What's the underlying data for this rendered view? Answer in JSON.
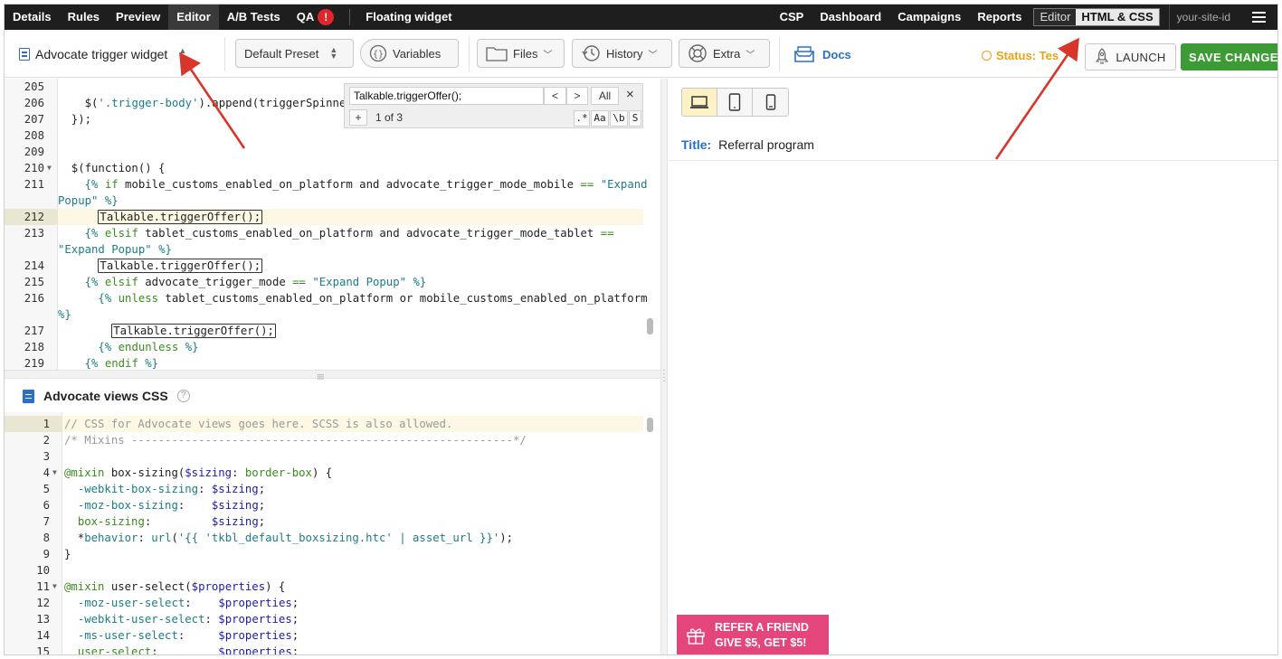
{
  "topnav": {
    "items": [
      {
        "label": "Details"
      },
      {
        "label": "Rules"
      },
      {
        "label": "Preview"
      },
      {
        "label": "Editor",
        "active": true
      },
      {
        "label": "A/B Tests"
      },
      {
        "label": "QA",
        "badge": "!"
      }
    ],
    "page_title": "Floating widget",
    "right_items": [
      {
        "label": "CSP"
      },
      {
        "label": "Dashboard"
      },
      {
        "label": "Campaigns"
      },
      {
        "label": "Reports"
      }
    ],
    "mode_switch": {
      "editor": "Editor",
      "html_css": "HTML & CSS"
    },
    "site_id": "your-site-id"
  },
  "toolbar": {
    "widget_select": "Advocate trigger widget",
    "preset": "Default Preset",
    "variables": "Variables",
    "files": "Files",
    "history": "History",
    "extra": "Extra",
    "docs": "Docs",
    "status": "Status: Tes",
    "launch": "LAUNCH",
    "save": "SAVE CHANGE"
  },
  "search": {
    "query": "Talkable.triggerOffer();",
    "prev": "<",
    "next": ">",
    "all": "All",
    "close": "×",
    "add": "+",
    "count": "1 of 3",
    "opt_regex": ".*",
    "opt_case": "Aa",
    "opt_word": "\\b",
    "opt_sel": "S"
  },
  "upper_code": [
    {
      "n": "205",
      "t": ""
    },
    {
      "n": "206",
      "t": "    $('.trigger-body').append(triggerSpinner"
    },
    {
      "n": "207",
      "t": "  });"
    },
    {
      "n": "208",
      "t": ""
    },
    {
      "n": "209",
      "t": ""
    },
    {
      "n": "210",
      "t": "  $(function() {",
      "fold": true
    },
    {
      "n": "211",
      "t": "    {% if mobile_customs_enabled_on_platform and advocate_trigger_mode_mobile == \"Expand"
    },
    {
      "n": "",
      "t": "Popup\" %}"
    },
    {
      "n": "212",
      "t": "      Talkable.triggerOffer();",
      "active": true
    },
    {
      "n": "213",
      "t": "    {% elsif tablet_customs_enabled_on_platform and advocate_trigger_mode_tablet =="
    },
    {
      "n": "",
      "t": "\"Expand Popup\" %}"
    },
    {
      "n": "214",
      "t": "      Talkable.triggerOffer();"
    },
    {
      "n": "215",
      "t": "    {% elsif advocate_trigger_mode == \"Expand Popup\" %}"
    },
    {
      "n": "216",
      "t": "      {% unless tablet_customs_enabled_on_platform or mobile_customs_enabled_on_platform"
    },
    {
      "n": "",
      "t": "%}"
    },
    {
      "n": "217",
      "t": "        Talkable.triggerOffer();"
    },
    {
      "n": "218",
      "t": "      {% endunless %}"
    },
    {
      "n": "219",
      "t": "    {% endif %}"
    }
  ],
  "css_panel": {
    "title": "Advocate views CSS",
    "help": "?"
  },
  "lower_code": [
    {
      "n": "1",
      "t": "// CSS for Advocate views goes here. SCSS is also allowed."
    },
    {
      "n": "2",
      "t": "/* Mixins ---------------------------------------------------------*/"
    },
    {
      "n": "3",
      "t": ""
    },
    {
      "n": "4",
      "t": "@mixin box-sizing($sizing: border-box) {"
    },
    {
      "n": "5",
      "t": "  -webkit-box-sizing: $sizing;"
    },
    {
      "n": "6",
      "t": "  -moz-box-sizing:    $sizing;"
    },
    {
      "n": "7",
      "t": "  box-sizing:         $sizing;"
    },
    {
      "n": "8",
      "t": "  *behavior: url('{{ 'tkbl_default_boxsizing.htc' | asset_url }}');"
    },
    {
      "n": "9",
      "t": "}"
    },
    {
      "n": "10",
      "t": ""
    },
    {
      "n": "11",
      "t": "@mixin user-select($properties) {"
    },
    {
      "n": "12",
      "t": "  -moz-user-select:    $properties;"
    },
    {
      "n": "13",
      "t": "  -webkit-user-select: $properties;"
    },
    {
      "n": "14",
      "t": "  -ms-user-select:     $properties;"
    },
    {
      "n": "15",
      "t": "  user-select:         $properties;"
    }
  ],
  "preview": {
    "title_label": "Title:",
    "title_value": "Referral program",
    "refer_line1": "REFER A FRIEND",
    "refer_line2": "GIVE $5, GET $5!"
  },
  "colors": {
    "nav_bg": "#1e1e1e",
    "accent_blue": "#2a6fc9",
    "save_green": "#3d9b35",
    "status_orange": "#e8a317",
    "refer_pink": "#e4457a",
    "arrow_red": "#d9352b"
  }
}
